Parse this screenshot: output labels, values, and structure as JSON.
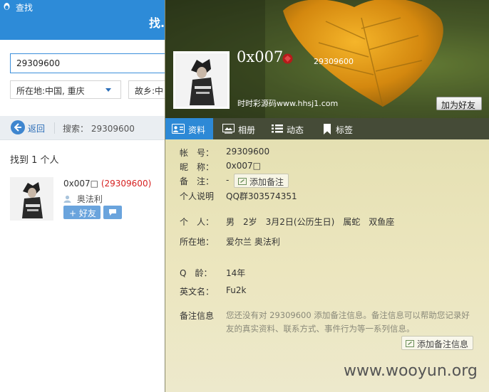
{
  "search_window": {
    "title": "查找",
    "find_tab": "找.",
    "search_value": "29309600",
    "location_select": "所在地:中国, 重庆",
    "hometown_select": "故乡:中",
    "back_label": "返回",
    "search_label": "搜索： 29309600",
    "result_count": "找到 1 个人",
    "result": {
      "name": "0x007□",
      "number": "(29309600)",
      "location": "奥法利",
      "add_label": "好友"
    }
  },
  "profile": {
    "nickname": "0x007",
    "qq_number": "29309600",
    "signature": "时时彩源码www.hhsj1.com",
    "add_friend_label": "加为好友",
    "tabs": [
      {
        "label": "资料",
        "icon": "profile-card-icon",
        "active": true
      },
      {
        "label": "相册",
        "icon": "photo-album-icon",
        "active": false
      },
      {
        "label": "动态",
        "icon": "feed-list-icon",
        "active": false
      },
      {
        "label": "标签",
        "icon": "bookmark-tag-icon",
        "active": false
      }
    ],
    "fields": {
      "account_label": "帐　号：",
      "account_value": "29309600",
      "nick_label": "昵　称：",
      "nick_value": "0x007□",
      "remark_label": "备　注：",
      "remark_value": "-",
      "add_remark_label": "添加备注",
      "bio_label": "个人说明",
      "bio_value": "QQ群303574351",
      "personal_label": "个　人：",
      "personal_value": "男　2岁　3月2日(公历生日)　属蛇　双鱼座",
      "location_label": "所在地：",
      "location_value": "爱尔兰 奥法利",
      "age_label": "Q　龄：",
      "age_value": "14年",
      "english_label": "英文名：",
      "english_value": "Fu2k",
      "note_label": "备注信息",
      "note_text": "您还没有对 29309600 添加备注信息。备注信息可以帮助您记录好友的真实资料、联系方式、事件行为等一系列信息。",
      "add_note_label": "添加备注信息"
    }
  },
  "watermark": "www.wooyun.org",
  "colors": {
    "header_blue": "#2d8bd8",
    "tab_active": "#2d89d6",
    "qq_number_red": "#d62020"
  }
}
